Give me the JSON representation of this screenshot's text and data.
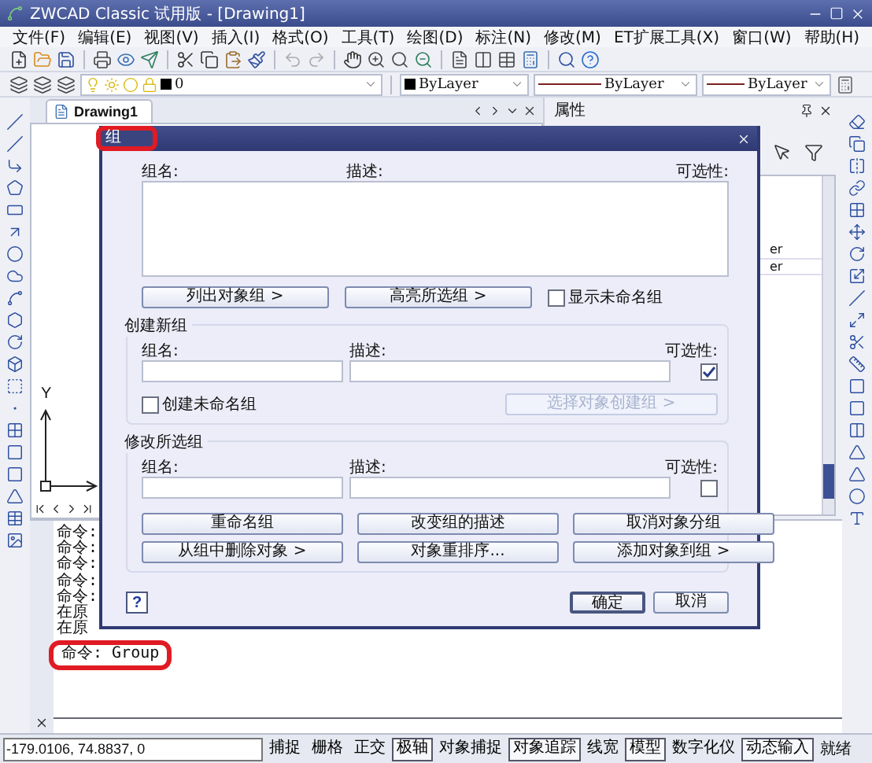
{
  "window": {
    "title": "ZWCAD Classic 试用版 - [Drawing1]"
  },
  "menu": [
    "文件(F)",
    "编辑(E)",
    "视图(V)",
    "插入(I)",
    "格式(O)",
    "工具(T)",
    "绘图(D)",
    "标注(N)",
    "修改(M)",
    "ET扩展工具(X)",
    "窗口(W)",
    "帮助(H)"
  ],
  "layer_bar": {
    "layer": "0",
    "color_value": "ByLayer",
    "linetype": "ByLayer",
    "lineweight": "ByLayer"
  },
  "document_tab": {
    "label": "Drawing1"
  },
  "drawing": {
    "axis_label": "Y"
  },
  "properties_panel": {
    "title": "属性",
    "values": [
      "er",
      "er"
    ]
  },
  "command_lines": [
    {
      "text": "命令:",
      "highlighted": false
    },
    {
      "text": "命令:",
      "highlighted": false
    },
    {
      "text": "命令:",
      "highlighted": false
    },
    {
      "text": "命令:",
      "highlighted": false
    },
    {
      "text": "命令:",
      "highlighted": false
    },
    {
      "text": "在原",
      "highlighted": false
    },
    {
      "text": "在原",
      "highlighted": false
    },
    {
      "text": "命令: Group",
      "highlighted": true
    }
  ],
  "status_bar": {
    "coords": "-179.0106,  74.8837,  0",
    "toggles": [
      {
        "label": "捕捉",
        "on": false
      },
      {
        "label": "栅格",
        "on": false
      },
      {
        "label": "正交",
        "on": false
      },
      {
        "label": "极轴",
        "on": true
      },
      {
        "label": "对象捕捉",
        "on": false
      },
      {
        "label": "对象追踪",
        "on": true
      },
      {
        "label": "线宽",
        "on": false
      },
      {
        "label": "模型",
        "on": true
      },
      {
        "label": "数字化仪",
        "on": false
      },
      {
        "label": "动态输入",
        "on": true
      }
    ],
    "state": "就绪"
  },
  "dialog": {
    "title": "组",
    "title_highlighted": true,
    "list_columns": [
      "组名:",
      "描述:",
      "可选性:"
    ],
    "list_buttons": [
      {
        "label": "列出对象组  >",
        "disabled": false
      },
      {
        "label": "高亮所选组  >",
        "disabled": false
      }
    ],
    "show_unnamed": {
      "label": "显示未命名组",
      "checked": false
    },
    "create_section": {
      "title": "创建新组",
      "name_label": "组名:",
      "desc_label": "描述:",
      "selectable_label": "可选性:",
      "selectable": true,
      "unnamed": {
        "label": "创建未命名组",
        "checked": false
      },
      "button": {
        "label": "选择对象创建组  >",
        "disabled": true
      }
    },
    "modify_section": {
      "title": "修改所选组",
      "name_label": "组名:",
      "desc_label": "描述:",
      "selectable_label": "可选性:",
      "selectable": false,
      "buttons": [
        {
          "label": "重命名组",
          "disabled": false
        },
        {
          "label": "改变组的描述",
          "disabled": false
        },
        {
          "label": "取消对象分组",
          "disabled": false
        },
        {
          "label": "从组中删除对象  >",
          "disabled": false
        },
        {
          "label": "对象重排序...",
          "disabled": false
        },
        {
          "label": "添加对象到组  >",
          "disabled": false
        }
      ]
    },
    "help": "?",
    "buttons": [
      {
        "label": "确定",
        "default": true
      },
      {
        "label": "取消",
        "default": false
      }
    ]
  }
}
